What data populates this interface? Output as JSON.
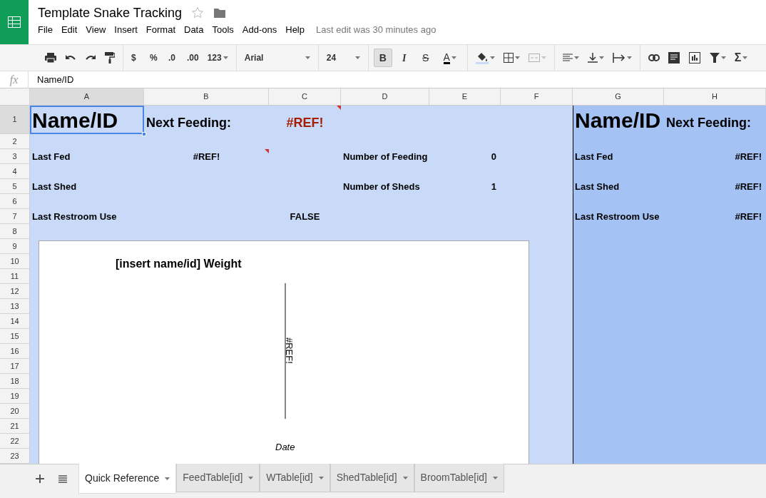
{
  "document": {
    "title": "Template Snake Tracking",
    "starred": false
  },
  "menu": [
    "File",
    "Edit",
    "View",
    "Insert",
    "Format",
    "Data",
    "Tools",
    "Add-ons",
    "Help"
  ],
  "last_edit": "Last edit was 30 minutes ago",
  "toolbar": {
    "number_formats": [
      "$",
      "%",
      ".0",
      ".00"
    ],
    "more_formats": "123",
    "font": "Arial",
    "font_size": "24",
    "styles": [
      {
        "label": "B",
        "pressed": true
      },
      {
        "label": "I",
        "pressed": false
      },
      {
        "label": "S",
        "pressed": false
      },
      {
        "label": "A",
        "pressed": false
      }
    ],
    "merge_disabled": true,
    "functions": "Σ"
  },
  "formula_bar": {
    "fx": "fx",
    "value": "Name/ID"
  },
  "columns": [
    {
      "header": "A",
      "color": "#c9daf8"
    },
    {
      "header": "B",
      "color": "#c9daf8"
    },
    {
      "header": "C",
      "color": "#c9daf8"
    },
    {
      "header": "D",
      "color": "#c9daf8"
    },
    {
      "header": "E",
      "color": "#c9daf8"
    },
    {
      "header": "F",
      "color": "#c9daf8"
    },
    {
      "header": "G",
      "color": "#a4c2f4"
    },
    {
      "header": "H",
      "color": "#a4c2f4"
    }
  ],
  "rows": [
    {
      "header": "1",
      "cells": {
        "A": {
          "text": "Name/ID",
          "kind": "title",
          "note": false,
          "selected": true
        },
        "B": {
          "text": "Next Feeding:",
          "kind": "heading",
          "note": false,
          "selected": false
        },
        "C": {
          "text": "#REF!",
          "kind": "error",
          "note": true,
          "selected": false
        },
        "G": {
          "text": "Name/ID",
          "kind": "title",
          "note": false,
          "selected": false
        },
        "H": {
          "text": "Next Feeding:",
          "kind": "heading",
          "note": false,
          "selected": false
        }
      }
    },
    {
      "header": "2"
    },
    {
      "header": "3",
      "cells": {
        "A": {
          "text": "Last Fed",
          "kind": "label",
          "note": false,
          "selected": false
        },
        "B": {
          "text": "#REF!",
          "kind": "label_centered",
          "note": true,
          "selected": false
        },
        "D": {
          "text": "Number of Feeding",
          "kind": "label",
          "note": false,
          "selected": false
        },
        "E": {
          "text": "0",
          "kind": "number",
          "note": false,
          "selected": false
        },
        "G": {
          "text": "Last Fed",
          "kind": "label",
          "note": false,
          "selected": false
        },
        "H": {
          "text": "#REF!",
          "kind": "number",
          "note": false,
          "selected": false
        }
      }
    },
    {
      "header": "4"
    },
    {
      "header": "5",
      "cells": {
        "A": {
          "text": "Last Shed",
          "kind": "label",
          "note": false,
          "selected": false
        },
        "D": {
          "text": "Number of Sheds",
          "kind": "label",
          "note": false,
          "selected": false
        },
        "E": {
          "text": "1",
          "kind": "number",
          "note": false,
          "selected": false
        },
        "G": {
          "text": "Last Shed",
          "kind": "label",
          "note": false,
          "selected": false
        },
        "H": {
          "text": "#REF!",
          "kind": "number",
          "note": false,
          "selected": false
        }
      }
    },
    {
      "header": "6"
    },
    {
      "header": "7",
      "cells": {
        "A": {
          "text": "Last Restroom Use",
          "kind": "label",
          "note": false,
          "selected": false
        },
        "C": {
          "text": "FALSE",
          "kind": "label_centered",
          "note": false,
          "selected": false
        },
        "G": {
          "text": "Last Restroom Use",
          "kind": "label",
          "note": false,
          "selected": false
        },
        "H": {
          "text": "#REF!",
          "kind": "number",
          "note": false,
          "selected": false
        }
      }
    },
    {
      "header": "8"
    },
    {
      "header": "9"
    },
    {
      "header": "10"
    },
    {
      "header": "11"
    },
    {
      "header": "12"
    },
    {
      "header": "13"
    },
    {
      "header": "14"
    },
    {
      "header": "15"
    },
    {
      "header": "16"
    },
    {
      "header": "17"
    },
    {
      "header": "18"
    },
    {
      "header": "19"
    },
    {
      "header": "20"
    },
    {
      "header": "21"
    },
    {
      "header": "22"
    },
    {
      "header": "23"
    }
  ],
  "chart": {
    "title": "[insert name/id] Weight",
    "ylabel": "#REF!",
    "xlabel": "Date"
  },
  "sheet_tabs": [
    {
      "label": "Quick Reference",
      "selected": true
    },
    {
      "label": "FeedTable[id]",
      "selected": false
    },
    {
      "label": "WTable[id]",
      "selected": false
    },
    {
      "label": "ShedTable[id]",
      "selected": false
    },
    {
      "label": "BroomTable[id]",
      "selected": false
    }
  ]
}
